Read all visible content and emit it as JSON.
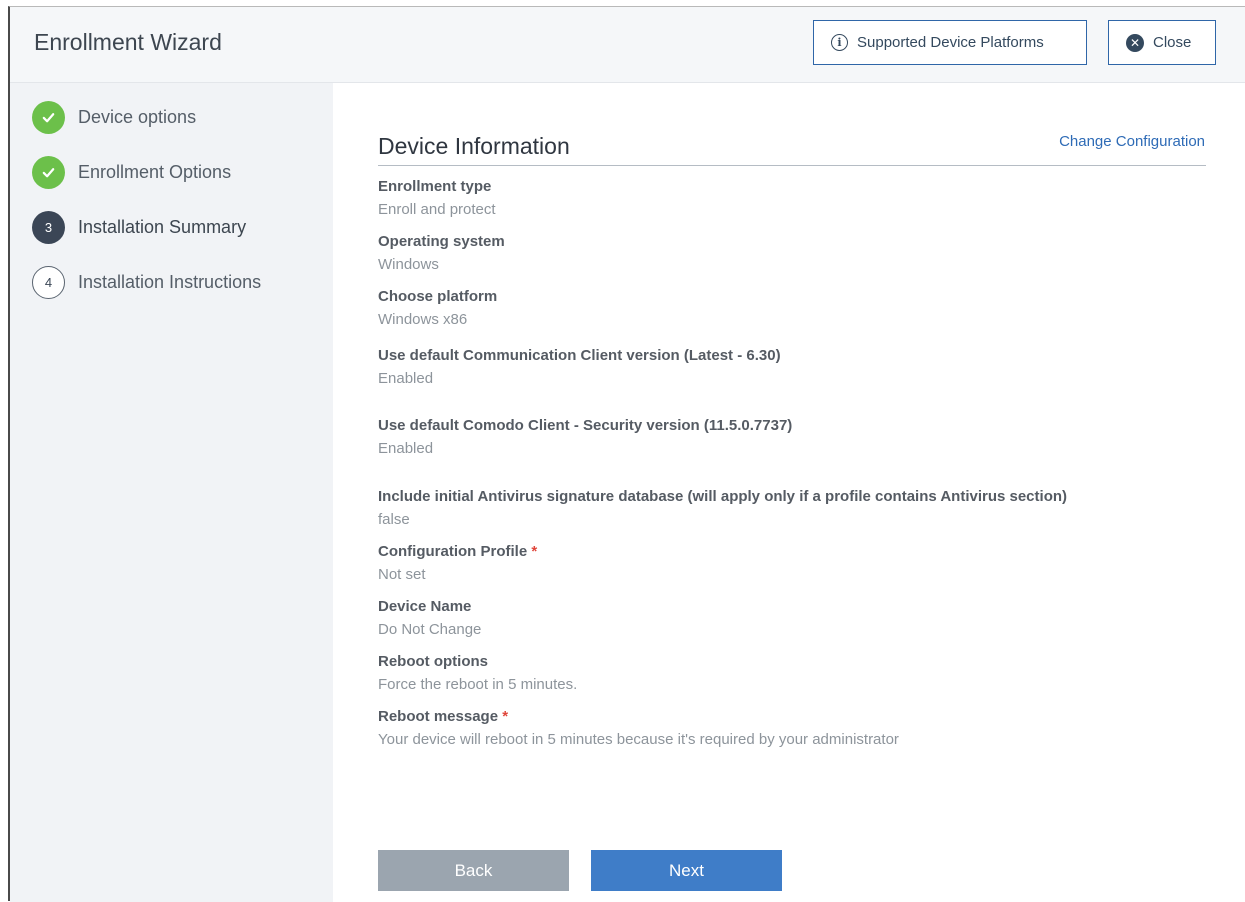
{
  "header": {
    "title": "Enrollment Wizard",
    "platforms_label": "Supported Device Platforms",
    "close_label": "Close"
  },
  "steps": [
    {
      "label": "Device options",
      "state": "done",
      "number": ""
    },
    {
      "label": "Enrollment Options",
      "state": "done",
      "number": ""
    },
    {
      "label": "Installation Summary",
      "state": "active",
      "number": "3"
    },
    {
      "label": "Installation Instructions",
      "state": "pending",
      "number": "4"
    }
  ],
  "main": {
    "section_title": "Device Information",
    "change_link": "Change Configuration",
    "fields": [
      {
        "label": "Enrollment type",
        "value": "Enroll and protect",
        "required": false
      },
      {
        "label": "Operating system",
        "value": "Windows",
        "required": false
      },
      {
        "label": "Choose platform",
        "value": "Windows x86",
        "required": false
      },
      {
        "label": "Use default Communication Client version (Latest - 6.30)",
        "value": "Enabled",
        "required": false
      },
      {
        "label": "Use default Comodo Client - Security version (11.5.0.7737)",
        "value": "Enabled",
        "required": false
      },
      {
        "label": "Include initial Antivirus signature database (will apply only if a profile contains Antivirus section)",
        "value": "false",
        "required": false
      },
      {
        "label": "Configuration Profile",
        "value": "Not set",
        "required": true
      },
      {
        "label": "Device Name",
        "value": "Do Not Change",
        "required": false
      },
      {
        "label": "Reboot options",
        "value": "Force the reboot in 5 minutes.",
        "required": false
      },
      {
        "label": "Reboot message",
        "value": "Your device will reboot in 5 minutes because it's required by your administrator",
        "required": true
      }
    ],
    "required_mark": "*"
  },
  "footer": {
    "back_label": "Back",
    "next_label": "Next"
  },
  "colors": {
    "accent": "#3f7dc8",
    "done": "#6cc04a",
    "disabled": "#9ba5af",
    "required": "#e0463b"
  }
}
